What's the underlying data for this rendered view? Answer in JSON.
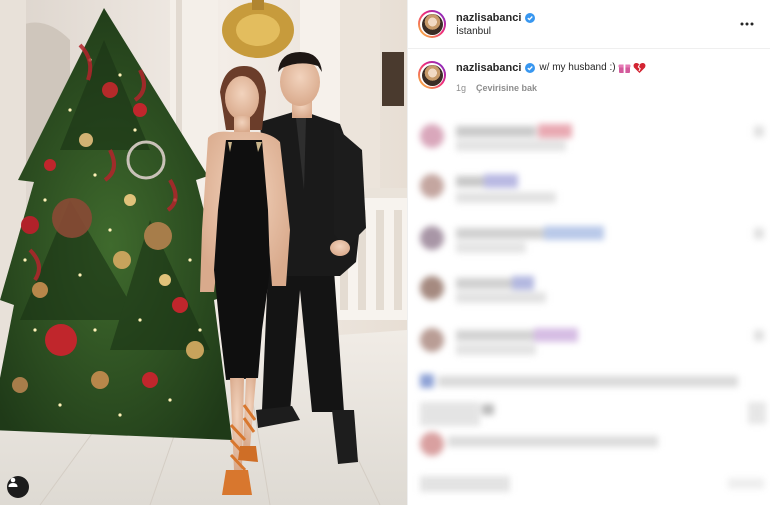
{
  "post": {
    "username": "nazlisabanci",
    "location": "İstanbul",
    "caption": "w/ my husband :)",
    "time_ago": "1g",
    "see_translation": "Çevirisine bak"
  },
  "icons": {
    "verified": "verified-badge-icon",
    "more": "more-options-icon",
    "tag": "user-tag-icon",
    "emoji_1": "gift-emoji-icon",
    "emoji_2": "broken-heart-emoji-icon"
  },
  "colors": {
    "verified_blue": "#3897f0",
    "story_ring_start": "#f9ce34",
    "story_ring_end": "#6228d7",
    "muted": "#8e8e8e"
  },
  "comments_obscured": true
}
